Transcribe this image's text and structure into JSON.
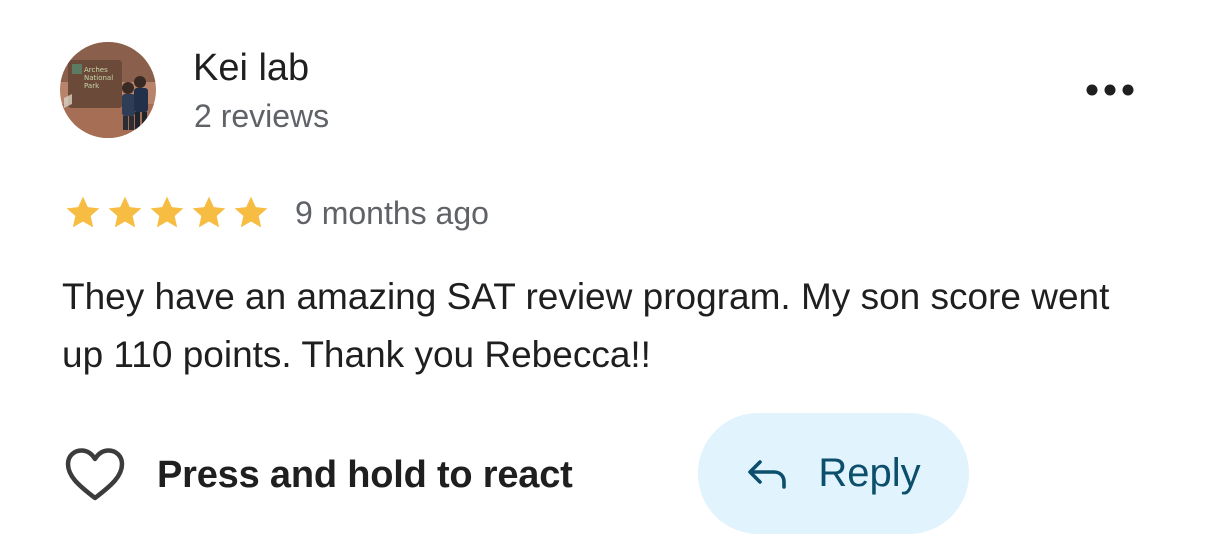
{
  "review": {
    "author": {
      "name": "Kei lab",
      "meta": "2 reviews",
      "avatar_icon": "user-photo-avatar",
      "avatar_sign_text": "Arches National Park"
    },
    "more_icon": "more-horizontal-icon",
    "rating": {
      "stars": 5,
      "max": 5,
      "star_color": "#f6bd42"
    },
    "time_ago": "9 months ago",
    "text": "They have an amazing SAT review program. My son score went up 110 points. Thank you Rebecca!!"
  },
  "actions": {
    "react_icon": "heart-outline-icon",
    "react_label": "Press and hold to react",
    "reply_icon": "reply-arrow-icon",
    "reply_label": "Reply",
    "reply_bg_color": "#e1f3fc",
    "reply_text_color": "#0b4f6c"
  }
}
